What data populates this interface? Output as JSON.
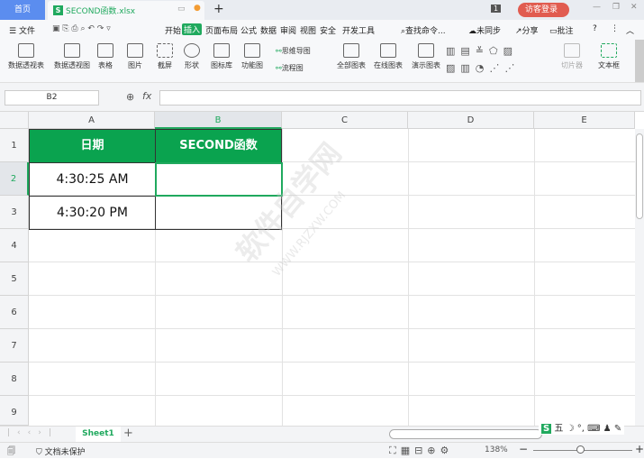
{
  "titlebar": {
    "home_tab": "首页",
    "file_name": "SECOND函数.xlsx",
    "new_tab": "+",
    "badge": "1",
    "login": "访客登录"
  },
  "menu": {
    "file": "文件",
    "tabs": [
      "开始",
      "插入",
      "页面布局",
      "公式",
      "数据",
      "审阅",
      "视图",
      "安全",
      "开发工具"
    ],
    "active_tab": "插入",
    "search": "查找命令...",
    "sync": "未同步",
    "share": "分享",
    "comment": "批注"
  },
  "ribbon": {
    "large": [
      "数据透视表",
      "数据透视图",
      "表格",
      "图片",
      "截屏",
      "形状",
      "图标库",
      "功能图",
      "全部图表",
      "在线图表",
      "演示图表",
      "切片器",
      "文本框"
    ],
    "small": [
      "思维导图",
      "流程图"
    ]
  },
  "formula_bar": {
    "cell_ref": "B2",
    "fx": "fx",
    "value": ""
  },
  "sheet": {
    "columns": [
      "A",
      "B",
      "C",
      "D",
      "E"
    ],
    "rows": [
      "1",
      "2",
      "3",
      "4",
      "5",
      "6",
      "7",
      "8",
      "9"
    ],
    "headers": [
      "日期",
      "SECOND函数"
    ],
    "data": [
      [
        "4:30:25 AM",
        ""
      ],
      [
        "4:30:20 PM",
        ""
      ]
    ],
    "selected_cell": "B2",
    "header_color": "#0aa34f"
  },
  "watermark": {
    "text": "软件自学网",
    "url": "WWW.RJZXW.COM"
  },
  "sheet_tabs": {
    "active": "Sheet1",
    "add": "+"
  },
  "status": {
    "protect": "文档未保护",
    "zoom": "138%",
    "ime": "五"
  }
}
